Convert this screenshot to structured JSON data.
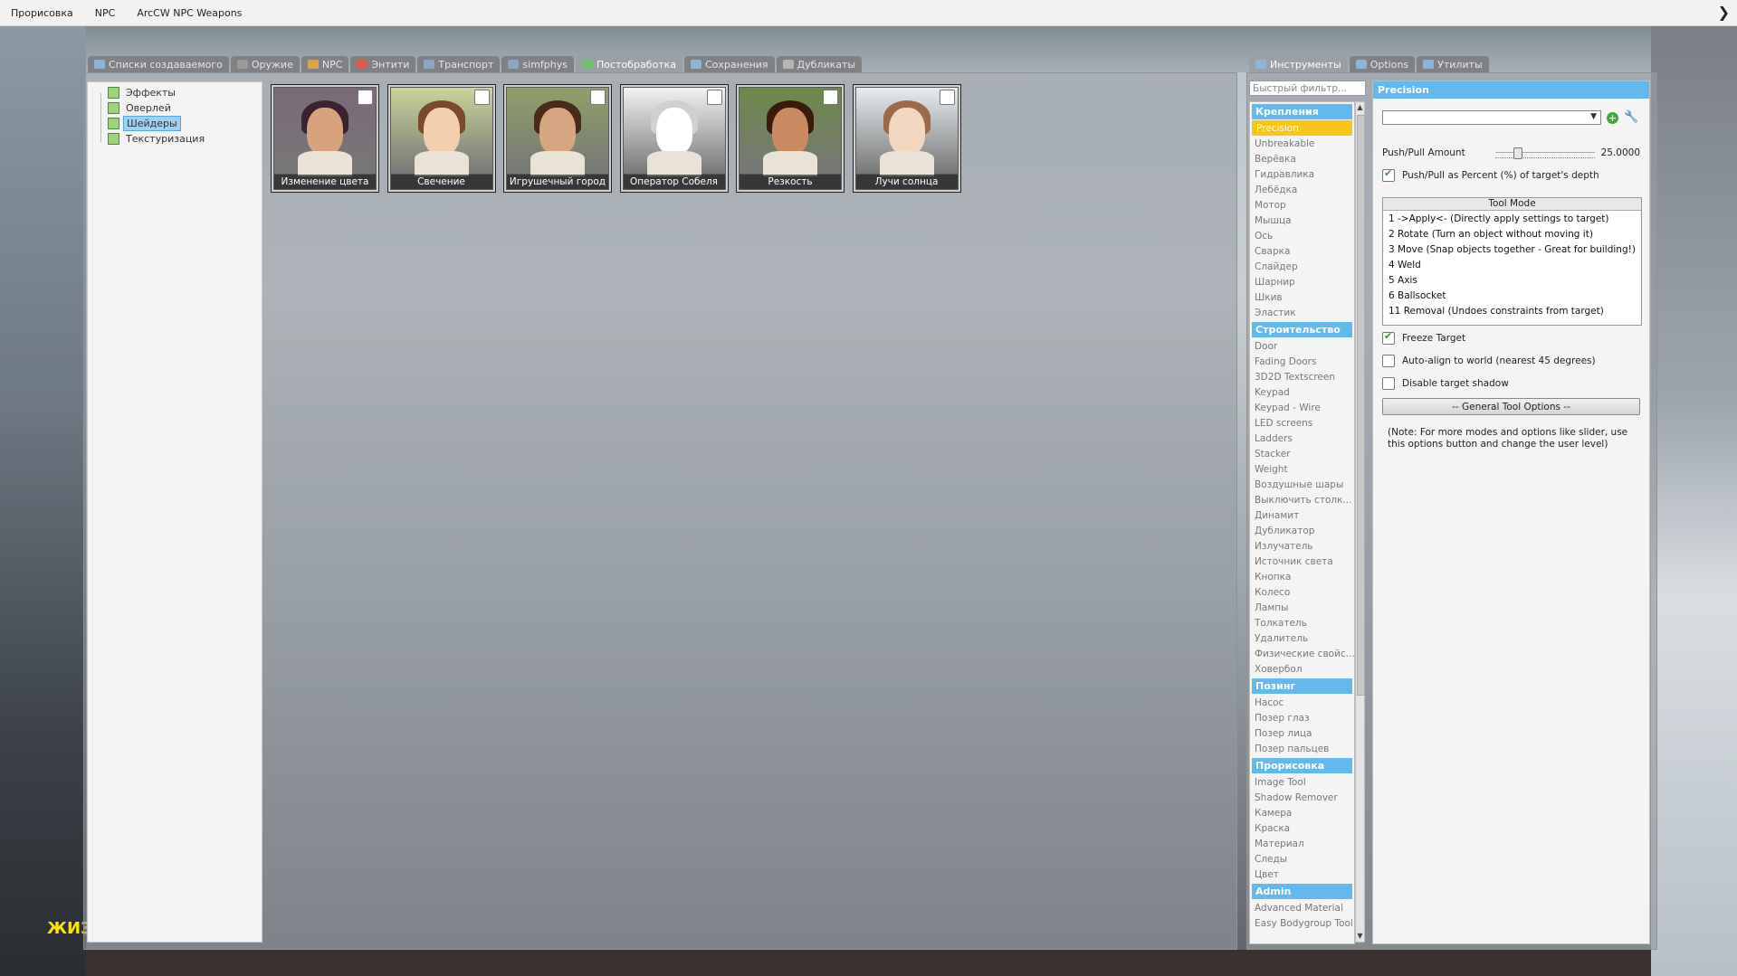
{
  "menubar": {
    "items": [
      "Прорисовка",
      "NPC",
      "ArcCW NPC Weapons"
    ]
  },
  "hud": {
    "health_label": "ЖИЗ"
  },
  "spawn_tabs": [
    {
      "label": "Списки создаваемого",
      "icon": "list-icon",
      "color": "#8fb5d6"
    },
    {
      "label": "Оружие",
      "icon": "weapon-icon",
      "color": "#9a9a9a"
    },
    {
      "label": "NPC",
      "icon": "npc-icon",
      "color": "#d9a54a"
    },
    {
      "label": "Энтити",
      "icon": "entity-icon",
      "color": "#d95b4a"
    },
    {
      "label": "Транспорт",
      "icon": "vehicle-icon",
      "color": "#8fa5c4"
    },
    {
      "label": "simfphys",
      "icon": "car-icon",
      "color": "#8fa5c4"
    },
    {
      "label": "Постобработка",
      "icon": "postprocess-icon",
      "color": "#6fbf6f"
    },
    {
      "label": "Сохранения",
      "icon": "save-icon",
      "color": "#8fb5d6"
    },
    {
      "label": "Дубликаты",
      "icon": "dupe-icon",
      "color": "#b5b5b5"
    }
  ],
  "tree": {
    "nodes": [
      {
        "label": "Эффекты",
        "selected": false
      },
      {
        "label": "Оверлей",
        "selected": false
      },
      {
        "label": "Шейдеры",
        "selected": true
      },
      {
        "label": "Текстуризация",
        "selected": false
      }
    ]
  },
  "thumbnails": [
    {
      "label": "Изменение цвета",
      "bg": "#7a6a78",
      "face": "#d9a27e",
      "hair": "#3a2230"
    },
    {
      "label": "Свечение",
      "bg": "#c9d39a",
      "face": "#f2cfae",
      "hair": "#7a4a2a"
    },
    {
      "label": "Игрушечный город",
      "bg": "#8fa06a",
      "face": "#d6a582",
      "hair": "#4a2a1a"
    },
    {
      "label": "Оператор Собеля",
      "bg": "#f2f2f2",
      "face": "#ffffff",
      "hair": "#d0d0d0"
    },
    {
      "label": "Резкость",
      "bg": "#6e8a4a",
      "face": "#c98a62",
      "hair": "#3a1a0a"
    },
    {
      "label": "Лучи солнца",
      "bg": "#e6ecef",
      "face": "#f2d6bf",
      "hair": "#9a6a4a"
    }
  ],
  "tool_tabs": [
    {
      "label": "Инструменты",
      "icon": "wrench-icon",
      "active": true
    },
    {
      "label": "Options",
      "icon": "options-icon",
      "active": false
    },
    {
      "label": "Утилиты",
      "icon": "utilities-icon",
      "active": false
    }
  ],
  "filter": {
    "placeholder": "Быстрый фильтр..."
  },
  "toollist": [
    {
      "type": "cat",
      "label": "Крепления"
    },
    {
      "type": "item",
      "label": "Precision",
      "selected": true
    },
    {
      "type": "item",
      "label": "Unbreakable"
    },
    {
      "type": "item",
      "label": "Верёвка"
    },
    {
      "type": "item",
      "label": "Гидравлика"
    },
    {
      "type": "item",
      "label": "Лебёдка"
    },
    {
      "type": "item",
      "label": "Мотор"
    },
    {
      "type": "item",
      "label": "Мышца"
    },
    {
      "type": "item",
      "label": "Ось"
    },
    {
      "type": "item",
      "label": "Сварка"
    },
    {
      "type": "item",
      "label": "Слайдер"
    },
    {
      "type": "item",
      "label": "Шарнир"
    },
    {
      "type": "item",
      "label": "Шкив"
    },
    {
      "type": "item",
      "label": "Эластик"
    },
    {
      "type": "cat",
      "label": "Строительство"
    },
    {
      "type": "item",
      "label": "Door"
    },
    {
      "type": "item",
      "label": "Fading Doors"
    },
    {
      "type": "item",
      "label": "3D2D Textscreen"
    },
    {
      "type": "item",
      "label": "Keypad"
    },
    {
      "type": "item",
      "label": "Keypad - Wire"
    },
    {
      "type": "item",
      "label": "LED screens"
    },
    {
      "type": "item",
      "label": "Ladders"
    },
    {
      "type": "item",
      "label": "Stacker"
    },
    {
      "type": "item",
      "label": "Weight"
    },
    {
      "type": "item",
      "label": "Воздушные шары"
    },
    {
      "type": "item",
      "label": "Выключить столк..."
    },
    {
      "type": "item",
      "label": "Динамит"
    },
    {
      "type": "item",
      "label": "Дубликатор"
    },
    {
      "type": "item",
      "label": "Излучатель"
    },
    {
      "type": "item",
      "label": "Источник света"
    },
    {
      "type": "item",
      "label": "Кнопка"
    },
    {
      "type": "item",
      "label": "Колесо"
    },
    {
      "type": "item",
      "label": "Лампы"
    },
    {
      "type": "item",
      "label": "Толкатель"
    },
    {
      "type": "item",
      "label": "Удалитель"
    },
    {
      "type": "item",
      "label": "Физические свойс..."
    },
    {
      "type": "item",
      "label": "Ховербол"
    },
    {
      "type": "cat",
      "label": "Позинг"
    },
    {
      "type": "item",
      "label": "Насос"
    },
    {
      "type": "item",
      "label": "Позер глаз"
    },
    {
      "type": "item",
      "label": "Позер лица"
    },
    {
      "type": "item",
      "label": "Позер пальцев"
    },
    {
      "type": "cat",
      "label": "Прорисовка"
    },
    {
      "type": "item",
      "label": "Image Tool"
    },
    {
      "type": "item",
      "label": "Shadow Remover"
    },
    {
      "type": "item",
      "label": "Камера"
    },
    {
      "type": "item",
      "label": "Краска"
    },
    {
      "type": "item",
      "label": "Материал"
    },
    {
      "type": "item",
      "label": "Следы"
    },
    {
      "type": "item",
      "label": "Цвет"
    },
    {
      "type": "cat",
      "label": "Admin"
    },
    {
      "type": "item",
      "label": "Advanced Material"
    },
    {
      "type": "item",
      "label": "Easy Bodygroup Tool"
    }
  ],
  "props": {
    "title": "Precision",
    "preset_value": "",
    "push_pull_label": "Push/Pull Amount",
    "push_pull_value": "25.0000",
    "push_pull_fraction": 0.2,
    "percent_label": "Push/Pull as Percent (%) of target's depth",
    "percent_checked": true,
    "tool_mode_header": "Tool Mode",
    "tool_modes": [
      "1  ->Apply<- (Directly apply settings to target)",
      "2   Rotate   (Turn an object without moving it)",
      "3   Move   (Snap objects together - Great for building!)",
      "4   Weld",
      "5   Axis",
      "6   Ballsocket",
      "11   Removal   (Undoes constraints from target)"
    ],
    "freeze_label": "Freeze Target",
    "freeze_checked": true,
    "autoalign_label": "Auto-align to world (nearest 45 degrees)",
    "autoalign_checked": false,
    "noshadow_label": "Disable target shadow",
    "noshadow_checked": false,
    "general_button": "-- General Tool Options --",
    "note": "(Note: For more modes and options like slider, use this options button and change the user level)"
  }
}
